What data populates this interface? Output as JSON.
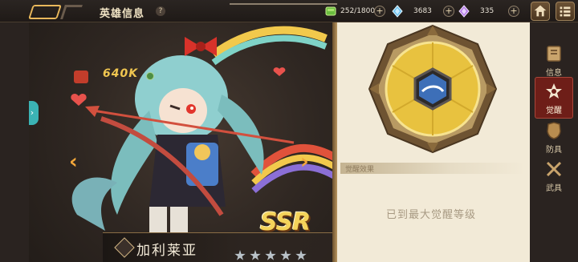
{
  "header": {
    "title": "英雄信息",
    "help_label": "?"
  },
  "resources": [
    {
      "icon": "stamina-gem-icon",
      "value": "252/1800",
      "plus": "+"
    },
    {
      "icon": "blue-crystal-icon",
      "value": "3683",
      "plus": "+"
    },
    {
      "icon": "purple-crystal-icon",
      "value": "335",
      "plus": "+"
    }
  ],
  "hero": {
    "power": "640K",
    "name": "加利莱亚",
    "rarity": "SSR",
    "stars": 5
  },
  "awaken": {
    "effect_label": "觉醒效果",
    "max_text": "已到最大觉醒等级"
  },
  "tabs": [
    {
      "label": "信息",
      "icon": "info-book-icon",
      "active": false
    },
    {
      "label": "觉醒",
      "icon": "awaken-icon",
      "active": true
    },
    {
      "label": "防具",
      "icon": "armor-icon",
      "active": false
    },
    {
      "label": "武具",
      "icon": "weapon-icon",
      "active": false
    }
  ],
  "colors": {
    "accent_gold": "#f0c650",
    "active_tab": "#6e1e18",
    "panel_bg": "#f2ead7"
  }
}
